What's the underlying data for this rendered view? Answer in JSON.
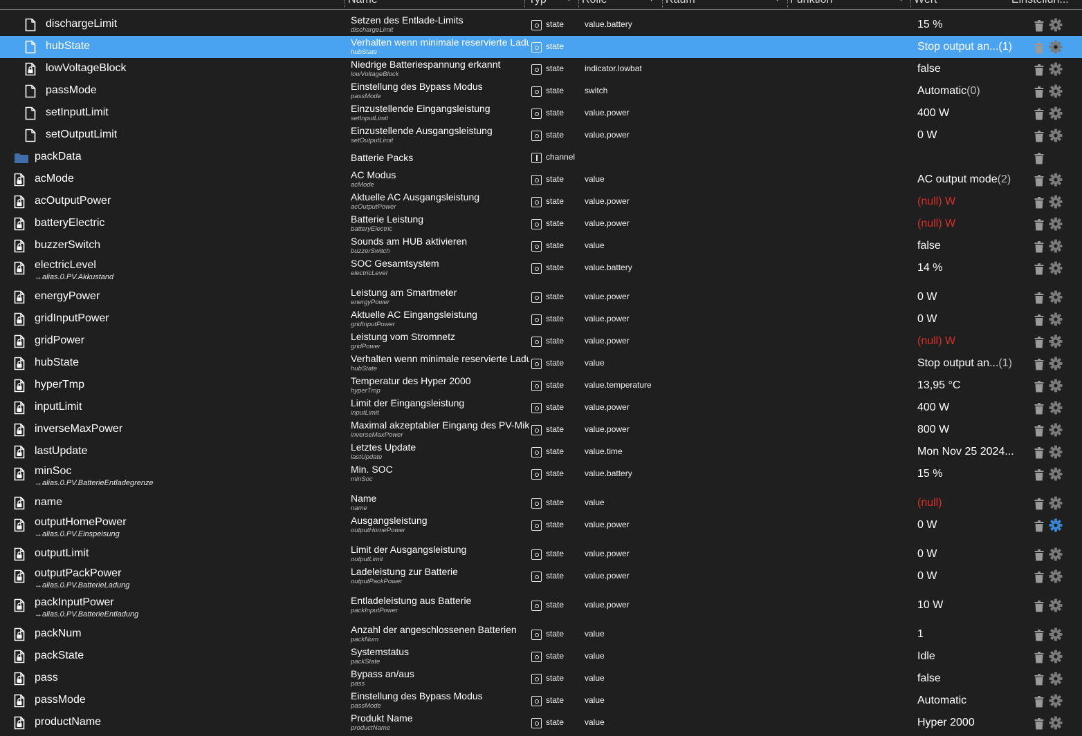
{
  "header": {
    "columns": [
      {
        "label": "Name"
      },
      {
        "label": "Typ"
      },
      {
        "label": "Rolle"
      },
      {
        "label": "Raum"
      },
      {
        "label": "Funktion"
      },
      {
        "label": "Wert"
      },
      {
        "label": "Einstellun..."
      }
    ]
  },
  "colors": {
    "background": "#1f1f1f",
    "selected_row": "#4aa3f0",
    "null_value": "#d9302a",
    "folder": "#3f6ea8",
    "active_gear": "#3a84d6"
  },
  "rows": [
    {
      "icon": "file-icon",
      "id": "dischargeLimit",
      "alias": "",
      "name": "Setzen des Entlade-Limits",
      "subname": "dischargeLimit",
      "type": "state",
      "role": "value.battery",
      "value": "15 %",
      "nullval": "",
      "suffix": "",
      "selected": false,
      "gear_active": false
    },
    {
      "icon": "file-icon",
      "id": "hubState",
      "alias": "",
      "name": "Verhalten wenn minimale reservierte Ladung erreicht",
      "subname": "hubState",
      "type": "state",
      "role": "",
      "value": "Stop output an...",
      "nullval": "",
      "suffix": "(1)",
      "selected": true,
      "gear_active": false
    },
    {
      "icon": "file-lock-icon",
      "id": "lowVoltageBlock",
      "alias": "",
      "name": "Niedrige Batteriespannung erkannt",
      "subname": "lowVoltageBlock",
      "type": "state",
      "role": "indicator.lowbat",
      "value": "false",
      "nullval": "",
      "suffix": "",
      "selected": false,
      "gear_active": false
    },
    {
      "icon": "file-icon",
      "id": "passMode",
      "alias": "",
      "name": "Einstellung des Bypass Modus",
      "subname": "passMode",
      "type": "state",
      "role": "switch",
      "value": "Automatic",
      "nullval": "",
      "suffix": "(0)",
      "selected": false,
      "gear_active": false
    },
    {
      "icon": "file-icon",
      "id": "setInputLimit",
      "alias": "",
      "name": "Einzustellende Eingangsleistung",
      "subname": "setInputLimit",
      "type": "state",
      "role": "value.power",
      "value": "400 W",
      "nullval": "",
      "suffix": "",
      "selected": false,
      "gear_active": false
    },
    {
      "icon": "file-icon",
      "id": "setOutputLimit",
      "alias": "",
      "name": "Einzustellende Ausgangsleistung",
      "subname": "setOutputLimit",
      "type": "state",
      "role": "value.power",
      "value": "0 W",
      "nullval": "",
      "suffix": "",
      "selected": false,
      "gear_active": false
    },
    {
      "icon": "folder-icon",
      "id": "packData",
      "alias": "",
      "name": "Batterie Packs",
      "subname": "",
      "type": "channel",
      "role": "",
      "value": "",
      "nullval": "",
      "suffix": "",
      "selected": false,
      "gear_active": false
    },
    {
      "icon": "file-lock-icon",
      "id": "acMode",
      "alias": "",
      "name": "AC Modus",
      "subname": "acMode",
      "type": "state",
      "role": "value",
      "value": "AC output mode",
      "nullval": "",
      "suffix": "(2)",
      "selected": false,
      "gear_active": false
    },
    {
      "icon": "file-lock-icon",
      "id": "acOutputPower",
      "alias": "",
      "name": "Aktuelle AC Ausgangsleistung",
      "subname": "acOutputPower",
      "type": "state",
      "role": "value.power",
      "value": "",
      "nullval": "(null) W",
      "suffix": "",
      "selected": false,
      "gear_active": false
    },
    {
      "icon": "file-lock-icon",
      "id": "batteryElectric",
      "alias": "",
      "name": "Batterie Leistung",
      "subname": "batteryElectric",
      "type": "state",
      "role": "value.power",
      "value": "",
      "nullval": "(null) W",
      "suffix": "",
      "selected": false,
      "gear_active": false
    },
    {
      "icon": "file-lock-icon",
      "id": "buzzerSwitch",
      "alias": "",
      "name": "Sounds am HUB aktivieren",
      "subname": "buzzerSwitch",
      "type": "state",
      "role": "value",
      "value": "false",
      "nullval": "",
      "suffix": "",
      "selected": false,
      "gear_active": false
    },
    {
      "icon": "file-lock-icon",
      "id": "electricLevel",
      "alias": "↔alias.0.PV.Akkustand",
      "name": "SOC Gesamtsystem",
      "subname": "electricLevel",
      "type": "state",
      "role": "value.battery",
      "value": "14 %",
      "nullval": "",
      "suffix": "",
      "selected": false,
      "gear_active": false
    },
    {
      "icon": "file-lock-icon",
      "id": "energyPower",
      "alias": "",
      "name": "Leistung am Smartmeter",
      "subname": "energyPower",
      "type": "state",
      "role": "value.power",
      "value": "0 W",
      "nullval": "",
      "suffix": "",
      "selected": false,
      "gear_active": false
    },
    {
      "icon": "file-lock-icon",
      "id": "gridInputPower",
      "alias": "",
      "name": "Aktuelle AC Eingangsleistung",
      "subname": "gridInputPower",
      "type": "state",
      "role": "value.power",
      "value": "0 W",
      "nullval": "",
      "suffix": "",
      "selected": false,
      "gear_active": false
    },
    {
      "icon": "file-lock-icon",
      "id": "gridPower",
      "alias": "",
      "name": "Leistung vom Stromnetz",
      "subname": "gridPower",
      "type": "state",
      "role": "value.power",
      "value": "",
      "nullval": "(null) W",
      "suffix": "",
      "selected": false,
      "gear_active": false
    },
    {
      "icon": "file-lock-icon",
      "id": "hubState",
      "alias": "",
      "name": "Verhalten wenn minimale reservierte Ladung erreicht",
      "subname": "hubState",
      "type": "state",
      "role": "value",
      "value": "Stop output an...",
      "nullval": "",
      "suffix": "(1)",
      "selected": false,
      "gear_active": false
    },
    {
      "icon": "file-lock-icon",
      "id": "hyperTmp",
      "alias": "",
      "name": "Temperatur des Hyper 2000",
      "subname": "hyperTmp",
      "type": "state",
      "role": "value.temperature",
      "value": "13,95 °C",
      "nullval": "",
      "suffix": "",
      "selected": false,
      "gear_active": false
    },
    {
      "icon": "file-lock-icon",
      "id": "inputLimit",
      "alias": "",
      "name": "Limit der Eingangsleistung",
      "subname": "inputLimit",
      "type": "state",
      "role": "value.power",
      "value": "400 W",
      "nullval": "",
      "suffix": "",
      "selected": false,
      "gear_active": false
    },
    {
      "icon": "file-lock-icon",
      "id": "inverseMaxPower",
      "alias": "",
      "name": "Maximal akzeptabler Eingang des PV-Mikrowechselrichters",
      "subname": "inverseMaxPower",
      "type": "state",
      "role": "value.power",
      "value": "800 W",
      "nullval": "",
      "suffix": "",
      "selected": false,
      "gear_active": false
    },
    {
      "icon": "file-lock-icon",
      "id": "lastUpdate",
      "alias": "",
      "name": "Letztes Update",
      "subname": "lastUpdate",
      "type": "state",
      "role": "value.time",
      "value": "Mon Nov 25 2024...",
      "nullval": "",
      "suffix": "",
      "selected": false,
      "gear_active": false
    },
    {
      "icon": "file-lock-icon",
      "id": "minSoc",
      "alias": "↔alias.0.PV.BatterieEntladegrenze",
      "name": "Min. SOC",
      "subname": "minSoc",
      "type": "state",
      "role": "value.battery",
      "value": "15 %",
      "nullval": "",
      "suffix": "",
      "selected": false,
      "gear_active": false
    },
    {
      "icon": "file-lock-icon",
      "id": "name",
      "alias": "",
      "name": "Name",
      "subname": "name",
      "type": "state",
      "role": "value",
      "value": "",
      "nullval": "(null)",
      "suffix": "",
      "selected": false,
      "gear_active": false
    },
    {
      "icon": "file-lock-icon",
      "id": "outputHomePower",
      "alias": "↔alias.0.PV.Einspeisung",
      "name": "Ausgangsleistung",
      "subname": "outputHomePower",
      "type": "state",
      "role": "value.power",
      "value": "0 W",
      "nullval": "",
      "suffix": "",
      "selected": false,
      "gear_active": true
    },
    {
      "icon": "file-lock-icon",
      "id": "outputLimit",
      "alias": "",
      "name": "Limit der Ausgangsleistung",
      "subname": "outputLimit",
      "type": "state",
      "role": "value.power",
      "value": "0 W",
      "nullval": "",
      "suffix": "",
      "selected": false,
      "gear_active": false
    },
    {
      "icon": "file-lock-icon",
      "id": "outputPackPower",
      "alias": "↔alias.0.PV.BatterieLadung",
      "name": "Ladeleistung zur Batterie",
      "subname": "outputPackPower",
      "type": "state",
      "role": "value.power",
      "value": "0 W",
      "nullval": "",
      "suffix": "",
      "selected": false,
      "gear_active": false
    },
    {
      "icon": "file-lock-icon",
      "id": "packInputPower",
      "alias": "↔alias.0.PV.BatterieEntladung",
      "name": "Entladeleistung aus Batterie",
      "subname": "packInputPower",
      "type": "state",
      "role": "value.power",
      "value": "10 W",
      "nullval": "",
      "suffix": "",
      "selected": false,
      "gear_active": false
    },
    {
      "icon": "file-lock-icon",
      "id": "packNum",
      "alias": "",
      "name": "Anzahl der angeschlossenen Batterien",
      "subname": "packNum",
      "type": "state",
      "role": "value",
      "value": "1",
      "nullval": "",
      "suffix": "",
      "selected": false,
      "gear_active": false
    },
    {
      "icon": "file-lock-icon",
      "id": "packState",
      "alias": "",
      "name": "Systemstatus",
      "subname": "packState",
      "type": "state",
      "role": "value",
      "value": "Idle",
      "nullval": "",
      "suffix": "",
      "selected": false,
      "gear_active": false
    },
    {
      "icon": "file-lock-icon",
      "id": "pass",
      "alias": "",
      "name": "Bypass an/aus",
      "subname": "pass",
      "type": "state",
      "role": "value",
      "value": "false",
      "nullval": "",
      "suffix": "",
      "selected": false,
      "gear_active": false
    },
    {
      "icon": "file-lock-icon",
      "id": "passMode",
      "alias": "",
      "name": "Einstellung des Bypass Modus",
      "subname": "passMode",
      "type": "state",
      "role": "value",
      "value": "Automatic",
      "nullval": "",
      "suffix": "",
      "selected": false,
      "gear_active": false
    },
    {
      "icon": "file-lock-icon",
      "id": "productName",
      "alias": "",
      "name": "Produkt Name",
      "subname": "productName",
      "type": "state",
      "role": "value",
      "value": "Hyper 2000",
      "nullval": "",
      "suffix": "",
      "selected": false,
      "gear_active": false
    }
  ]
}
